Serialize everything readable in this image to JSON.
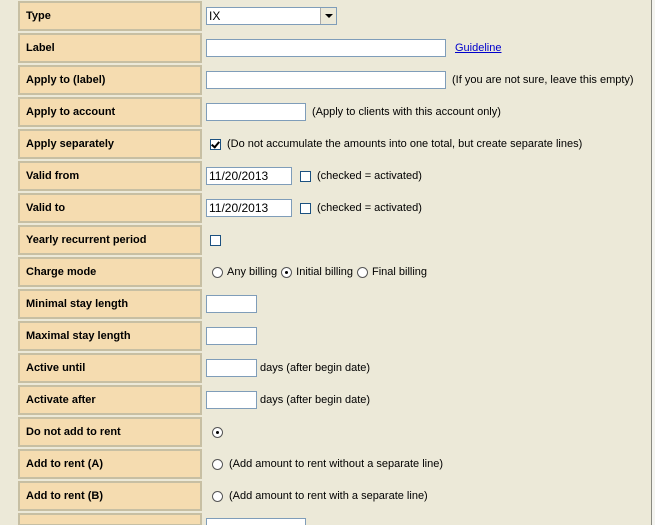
{
  "rows": [
    {
      "label": "Type"
    },
    {
      "label": "Label"
    },
    {
      "label": "Apply to (label)"
    },
    {
      "label": "Apply to account"
    },
    {
      "label": "Apply separately"
    },
    {
      "label": "Valid from"
    },
    {
      "label": "Valid to"
    },
    {
      "label": "Yearly recurrent period"
    },
    {
      "label": "Charge mode"
    },
    {
      "label": "Minimal stay length"
    },
    {
      "label": "Maximal stay length"
    },
    {
      "label": "Active until"
    },
    {
      "label": "Activate after"
    },
    {
      "label": "Do not add to rent"
    },
    {
      "label": "Add to rent (A)"
    },
    {
      "label": "Add to rent (B)"
    }
  ],
  "type_select": {
    "value": "IX"
  },
  "label_field": {
    "value": "",
    "link": "Guideline"
  },
  "apply_label": {
    "value": "",
    "hint": "(If you are not sure, leave this empty)"
  },
  "apply_account": {
    "value": "",
    "hint": "(Apply to clients with this account only)"
  },
  "apply_separately": {
    "checked": true,
    "hint": "(Do not accumulate the amounts into one total, but create separate lines)"
  },
  "valid_from": {
    "value": "11/20/2013",
    "checked": false,
    "hint": "(checked = activated)"
  },
  "valid_to": {
    "value": "11/20/2013",
    "checked": false,
    "hint": "(checked = activated)"
  },
  "yearly": {
    "checked": false
  },
  "charge_mode": {
    "options": [
      "Any billing",
      "Initial billing",
      "Final billing"
    ],
    "selected": "Initial billing"
  },
  "min_stay": {
    "value": ""
  },
  "max_stay": {
    "value": ""
  },
  "active_until": {
    "value": "",
    "hint": "days (after begin date)"
  },
  "activate_after": {
    "value": "",
    "hint": "days (after begin date)"
  },
  "no_rent": {
    "selected": true
  },
  "rent_a": {
    "selected": false,
    "hint": "(Add amount to rent without a separate line)"
  },
  "rent_b": {
    "selected": false,
    "hint": "(Add amount to rent with a separate line)"
  }
}
